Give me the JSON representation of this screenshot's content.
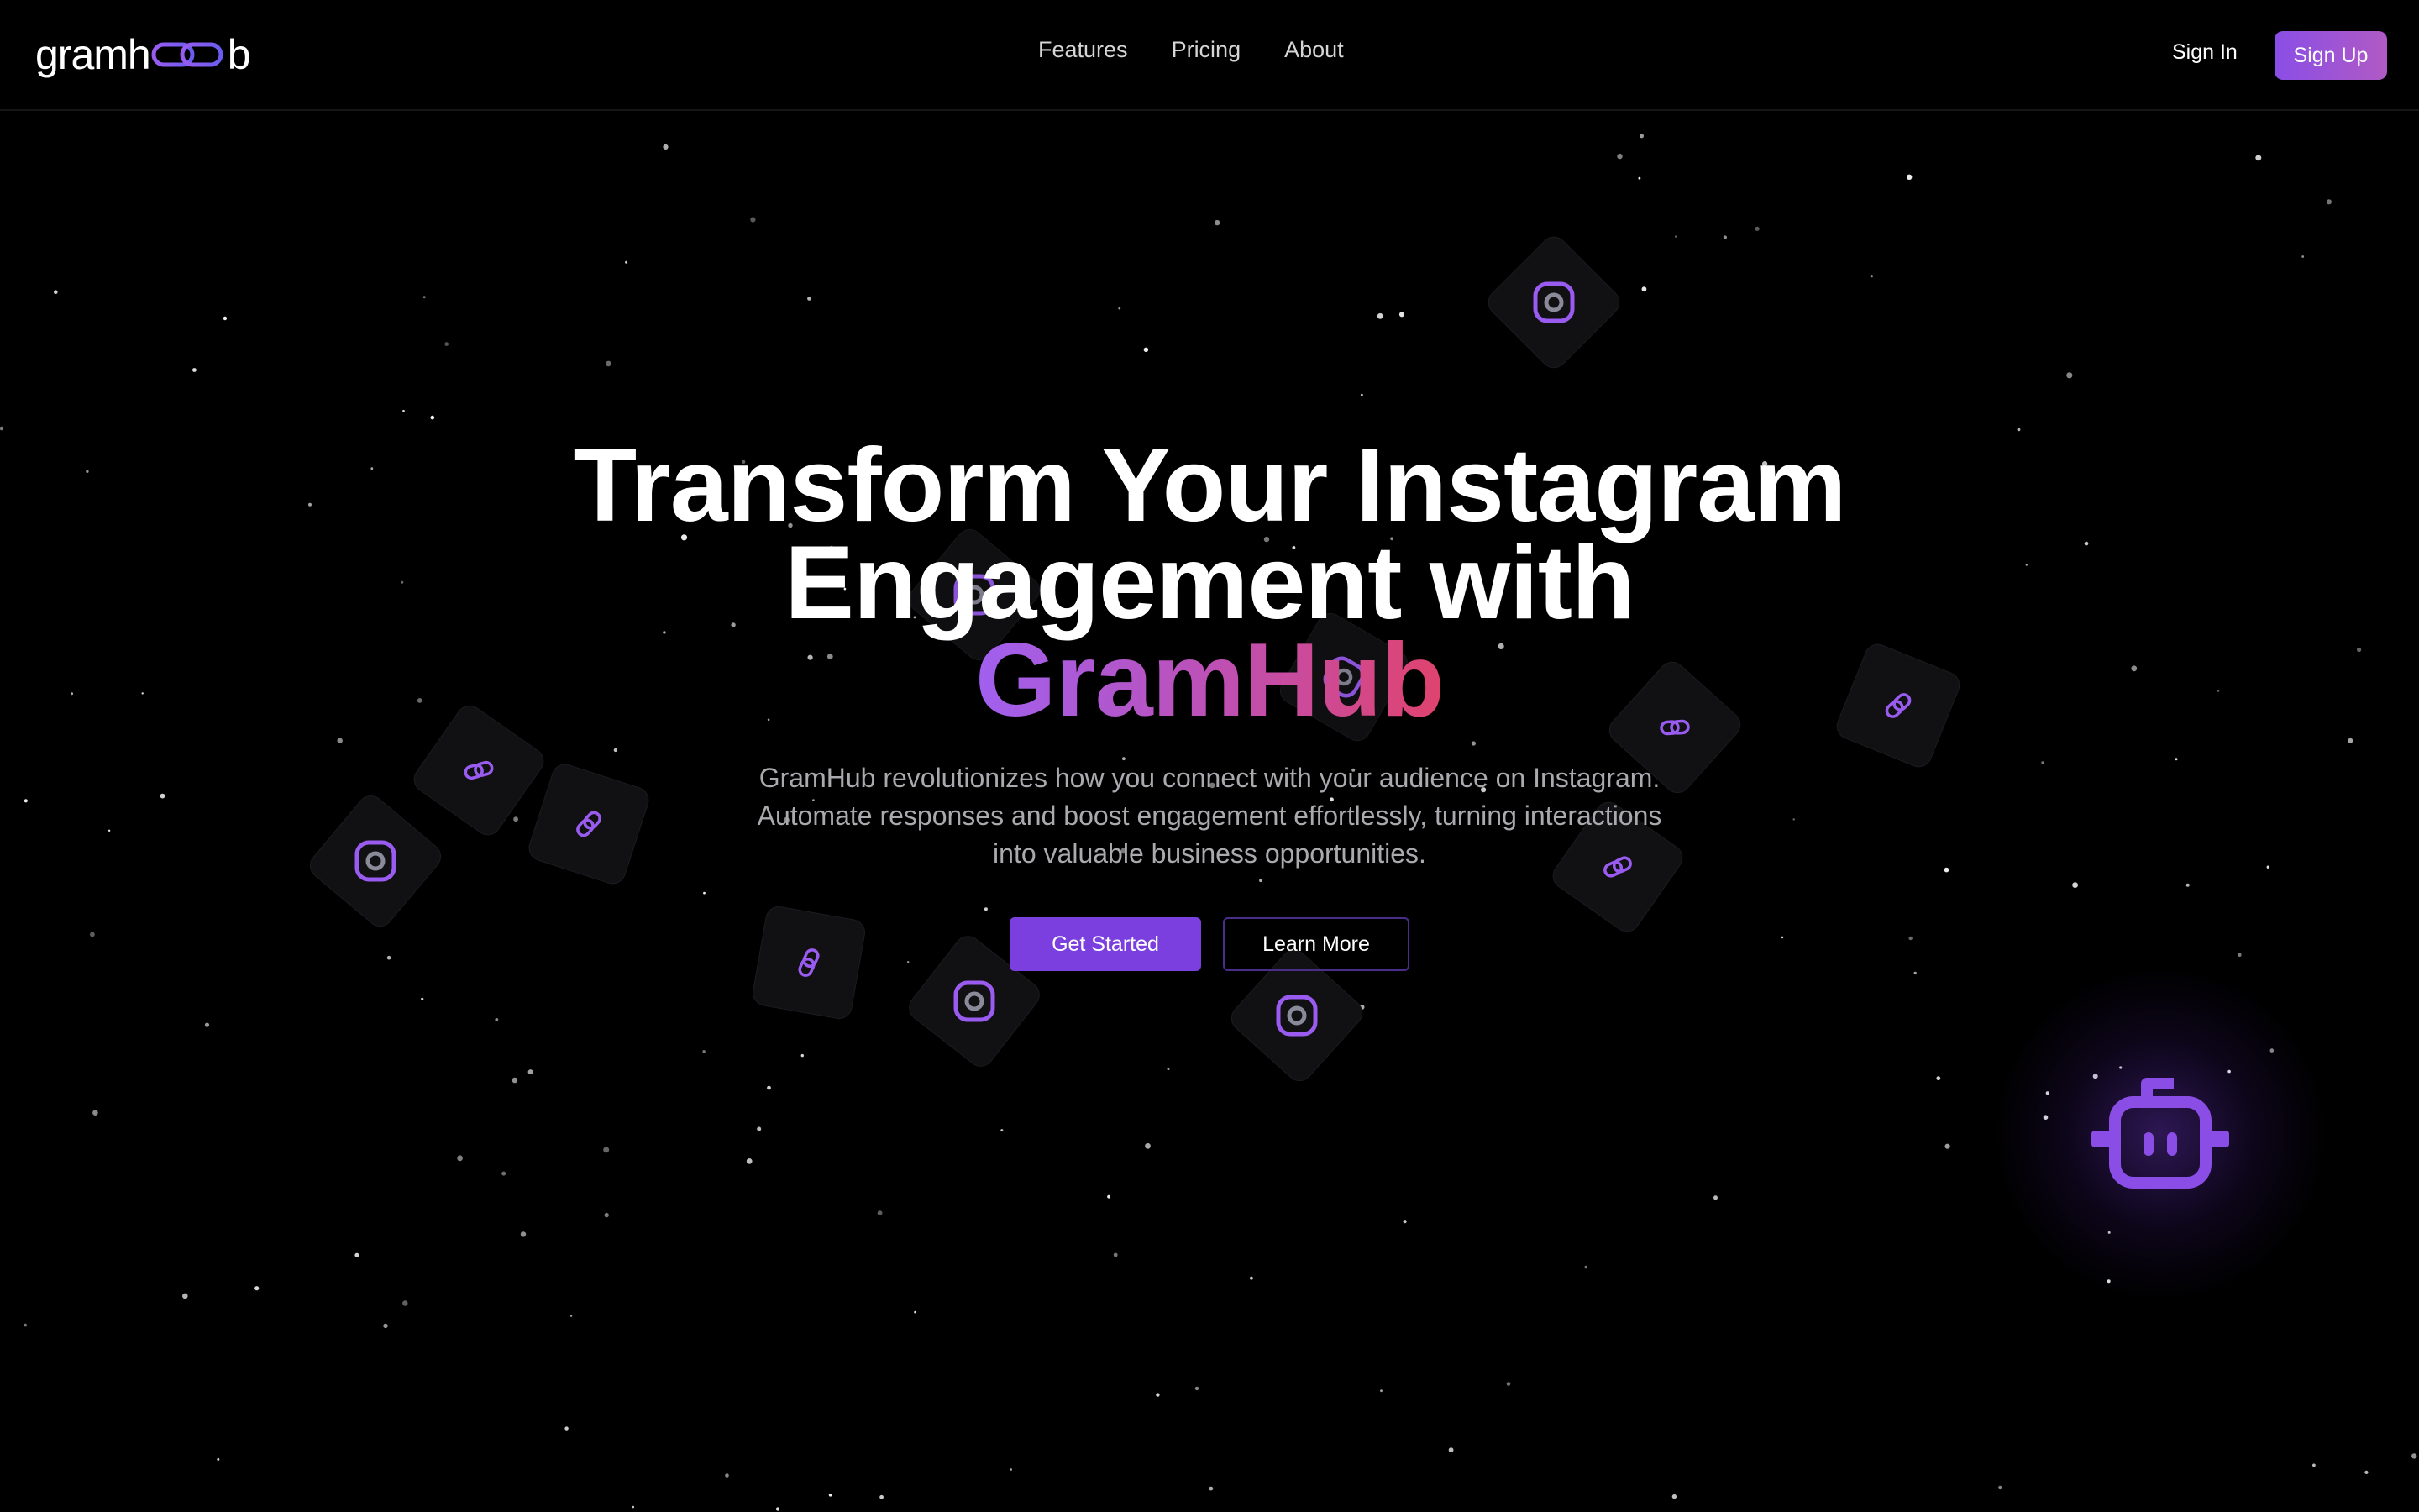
{
  "header": {
    "logo": {
      "text_left": "gramh",
      "text_right": "b",
      "icon": "chain-link-logo-icon"
    },
    "nav": [
      "Features",
      "Pricing",
      "About"
    ],
    "sign_in": "Sign In",
    "sign_up": "Sign Up"
  },
  "hero": {
    "title_line1": "Transform Your Instagram",
    "title_line2": "Engagement with",
    "title_brand": "GramHub",
    "subtitle": "GramHub revolutionizes how you connect with your audience on Instagram. Automate responses and boost engagement effortlessly, turning interactions into valuable business opportunities.",
    "primary_cta": "Get Started",
    "secondary_cta": "Learn More"
  },
  "floating_icons": [
    "instagram-icon",
    "link-icon"
  ],
  "chat_widget": {
    "icon": "bot-icon"
  },
  "colors": {
    "background": "#000000",
    "accent": "#7a3fde",
    "accent_light": "#9a5cf0",
    "brand_gradient_end": "#e0436e",
    "text_muted": "#a9a9ae"
  }
}
